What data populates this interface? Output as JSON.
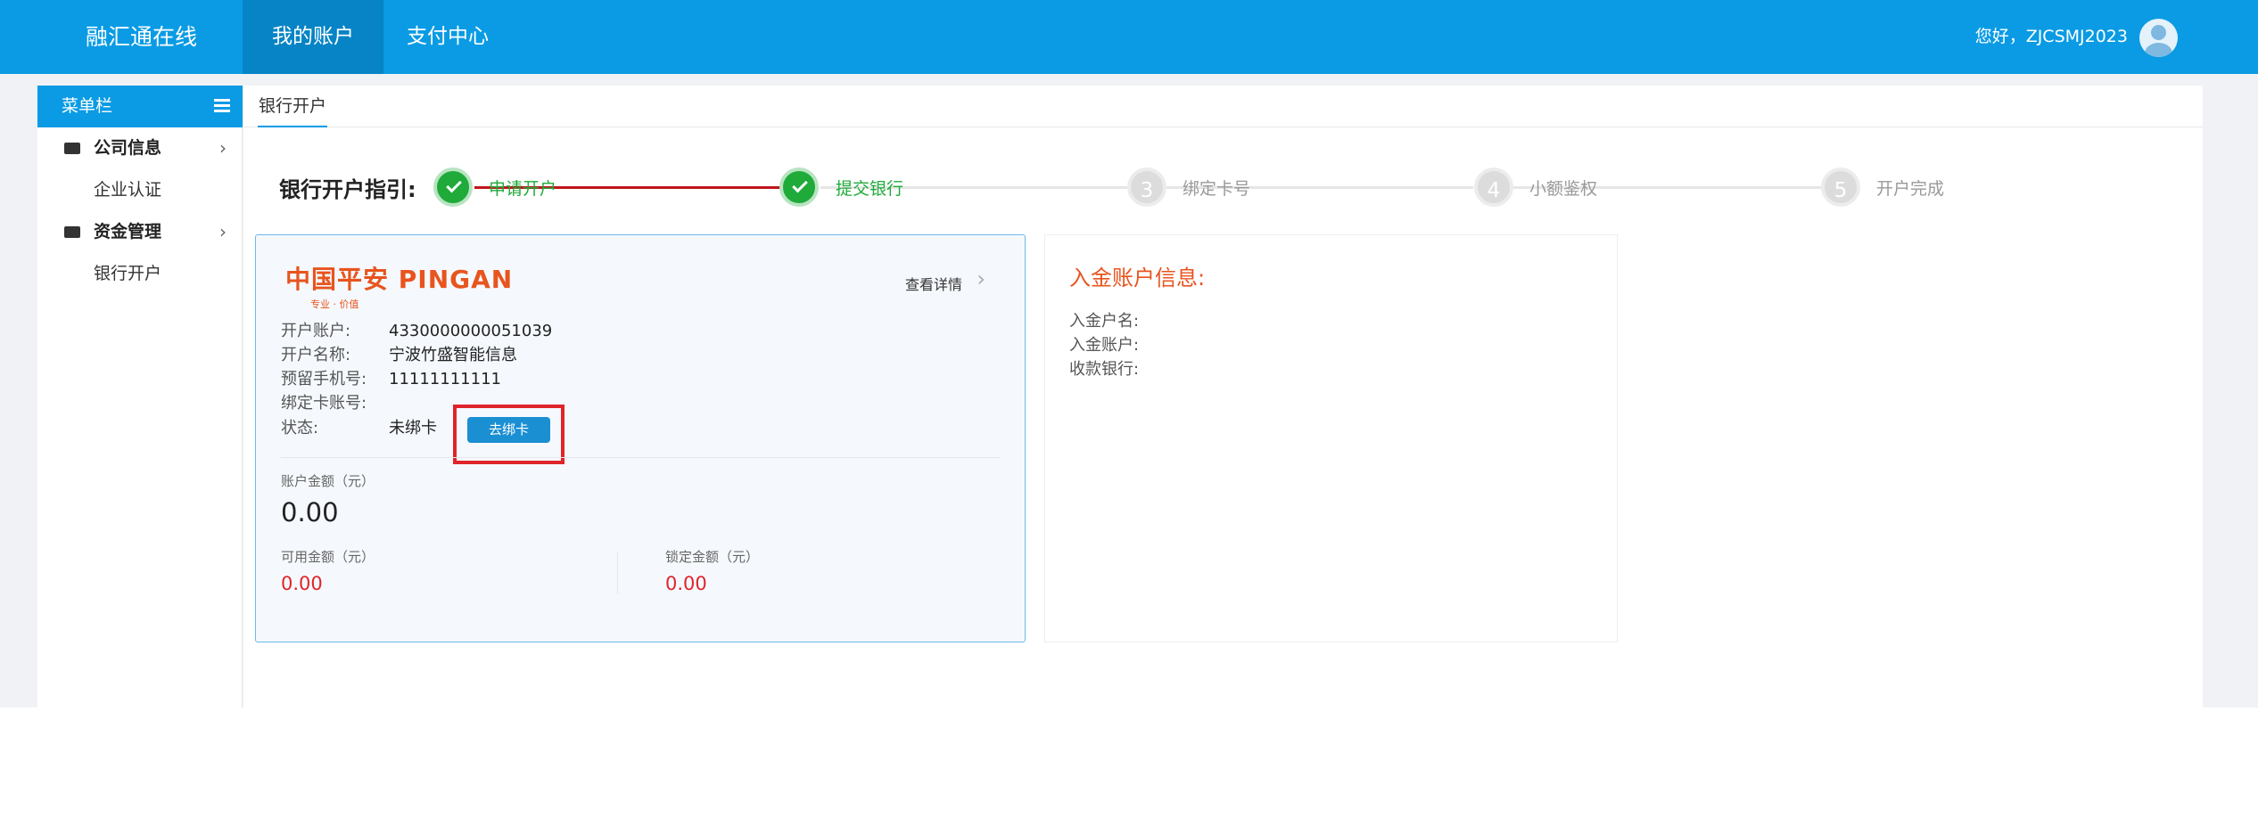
{
  "header": {
    "brand": "融汇通在线",
    "nav": [
      "我的账户",
      "支付中心"
    ],
    "greeting": "您好，ZJCSMJ2023"
  },
  "sidebar": {
    "title": "菜单栏",
    "groups": [
      {
        "label": "公司信息",
        "items": [
          "企业认证"
        ]
      },
      {
        "label": "资金管理",
        "items": [
          "银行开户"
        ]
      }
    ]
  },
  "tabs": [
    "银行开户"
  ],
  "guide": {
    "label": "银行开户指引:",
    "steps": [
      {
        "number": "1",
        "label": "申请开户",
        "done": true
      },
      {
        "number": "2",
        "label": "提交银行",
        "done": true
      },
      {
        "number": "3",
        "label": "绑定卡号",
        "done": false
      },
      {
        "number": "4",
        "label": "小额鉴权",
        "done": false
      },
      {
        "number": "5",
        "label": "开户完成",
        "done": false
      }
    ]
  },
  "bank_card": {
    "logo_text": "中国平安 PINGAN",
    "logo_slogan": "专业 · 价值",
    "detail_link": "查看详情",
    "fields": [
      {
        "label": "开户账户:",
        "value": "4330000000051039"
      },
      {
        "label": "开户名称:",
        "value": "宁波竹盛智能信息"
      },
      {
        "label": "预留手机号:",
        "value": "11111111111"
      },
      {
        "label": "绑定卡账号:",
        "value": ""
      },
      {
        "label": "状态:",
        "value": "未绑卡"
      }
    ],
    "bind_button": "去绑卡",
    "balance_label": "账户金额（元）",
    "balance": "0.00",
    "available_label": "可用金额（元）",
    "available": "0.00",
    "locked_label": "锁定金额（元）",
    "locked": "0.00"
  },
  "deposit": {
    "title": "入金账户信息:",
    "rows": [
      "入金户名:",
      "入金账户:",
      "收款银行:"
    ]
  },
  "colors": {
    "primary": "#0a9be4",
    "success": "#1faa3a",
    "accent": "#e8541e",
    "danger": "#e0242b"
  }
}
